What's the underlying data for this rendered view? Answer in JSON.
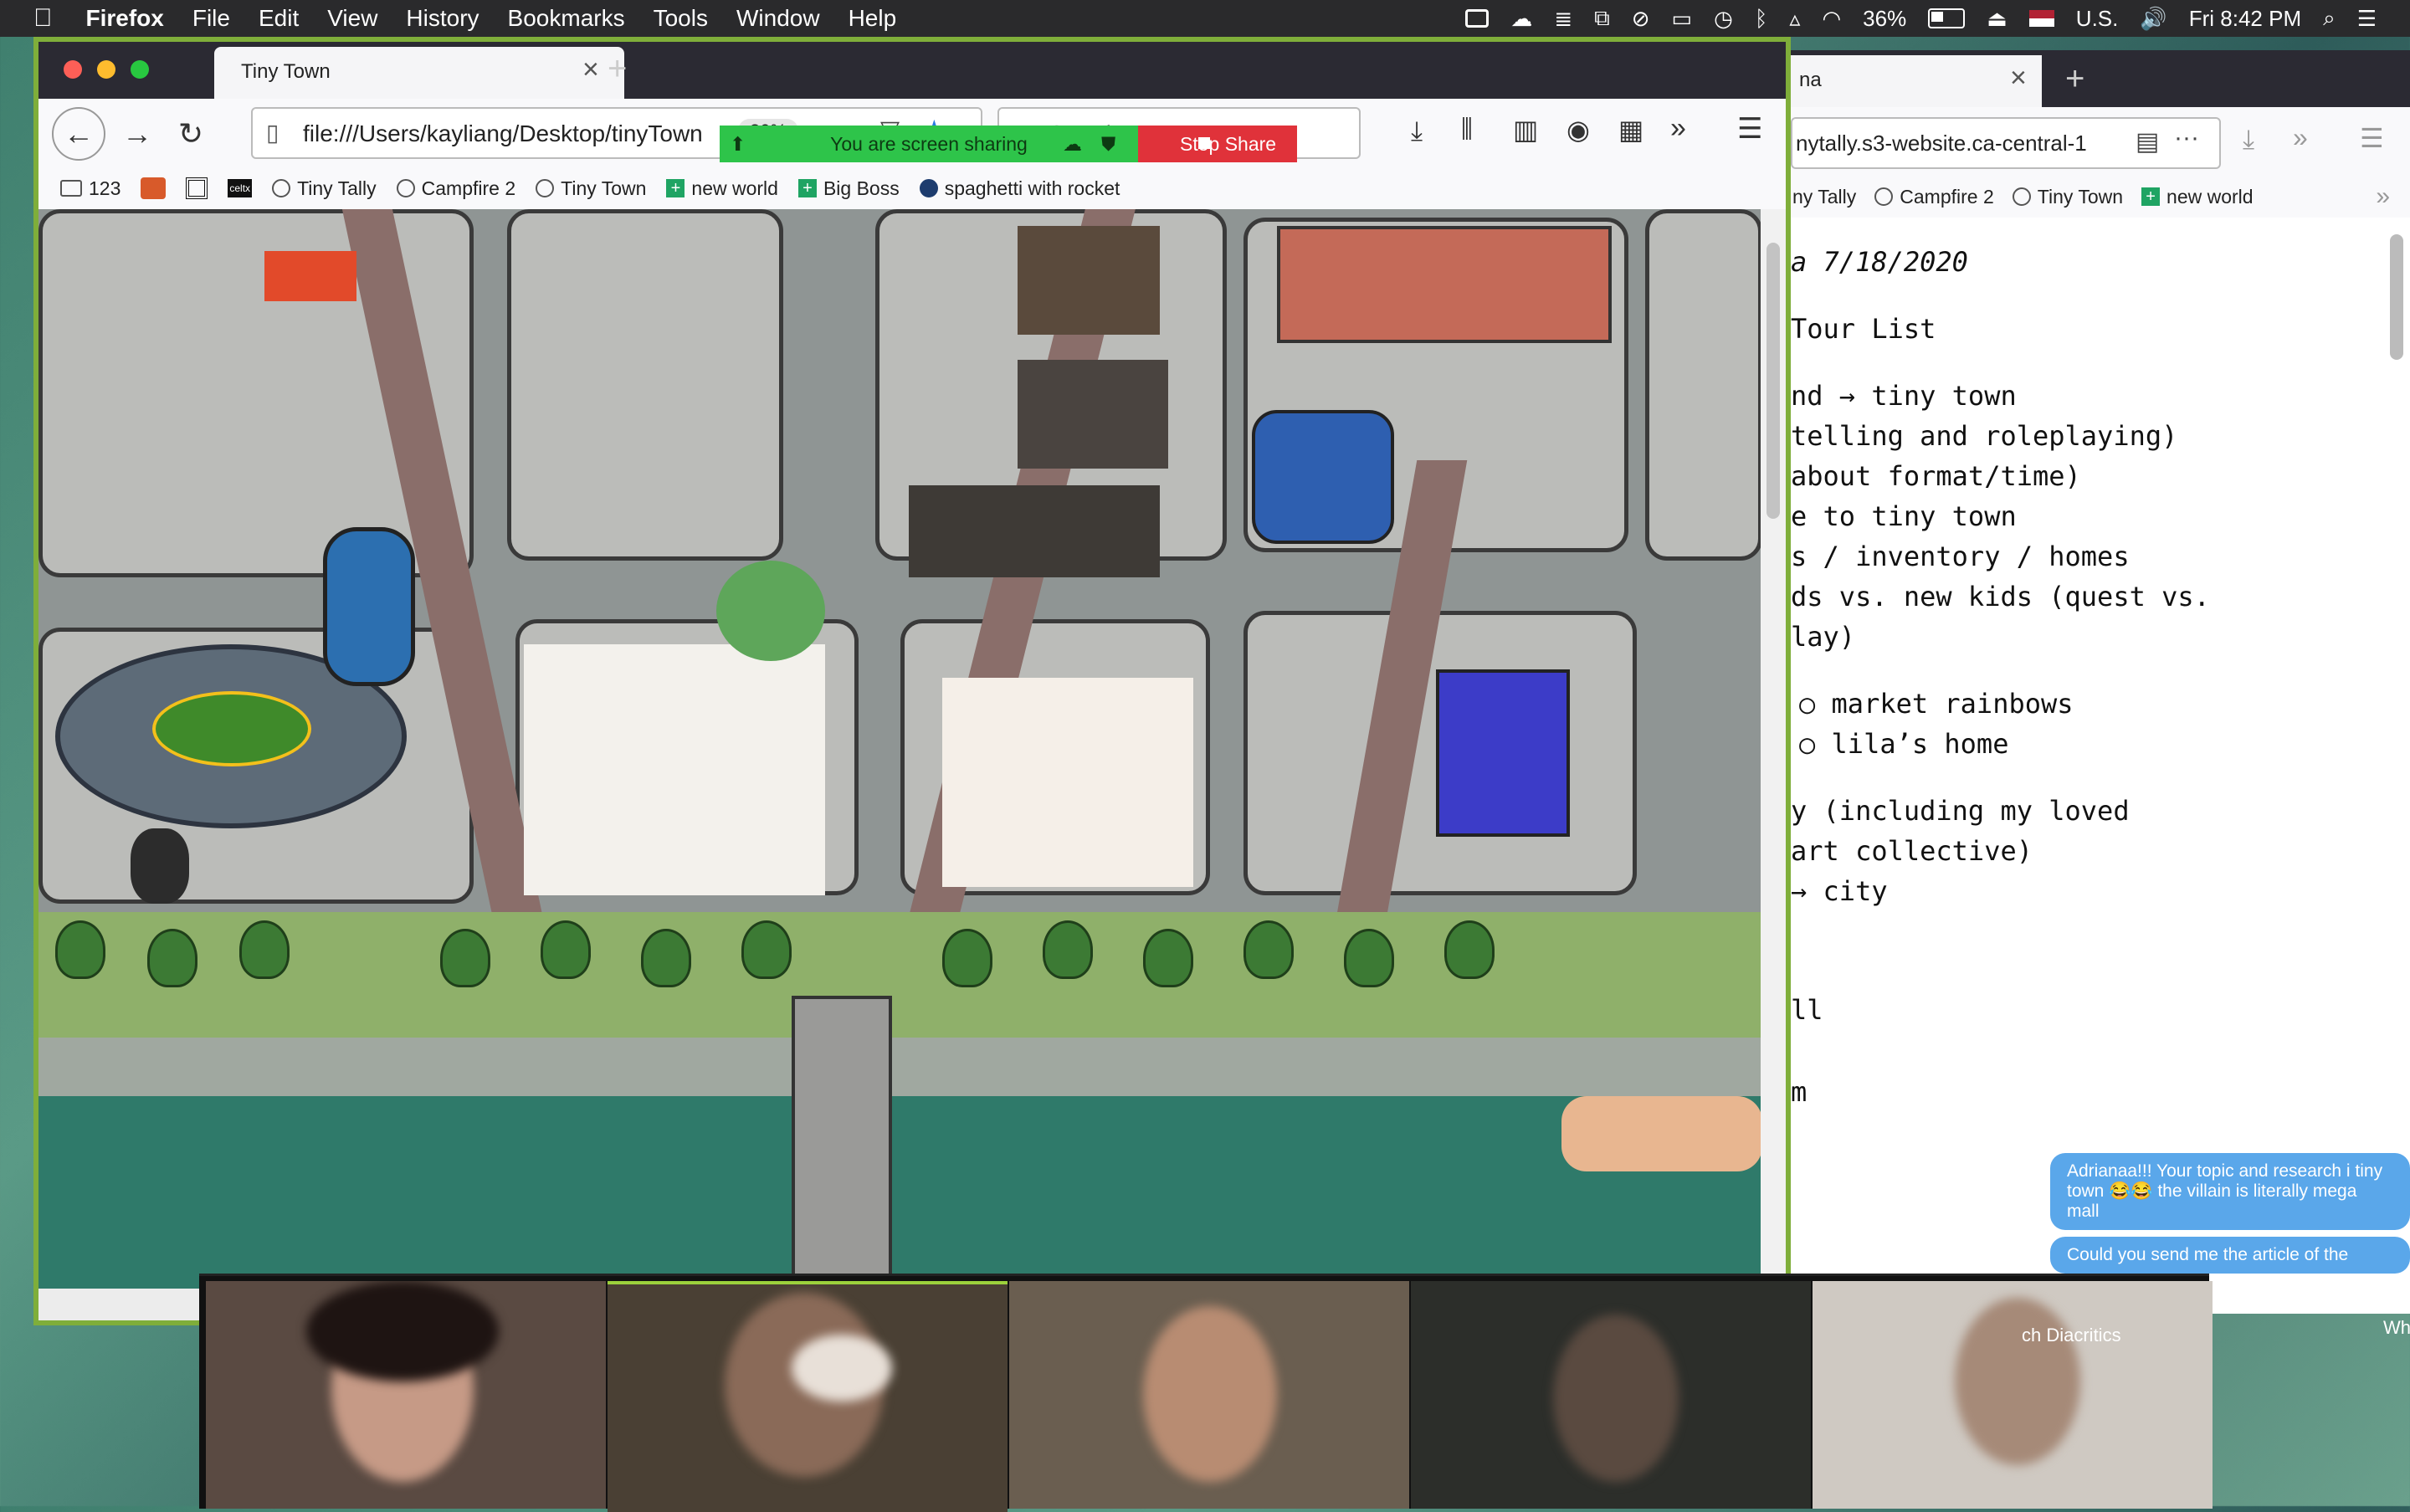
{
  "menubar": {
    "apple": "",
    "app": "Firefox",
    "menus": [
      "File",
      "Edit",
      "View",
      "History",
      "Bookmarks",
      "Tools",
      "Window",
      "Help"
    ],
    "battery": "36%",
    "input_source": "U.S.",
    "clock": "Fri 8:42 PM"
  },
  "browser_left": {
    "tab_title": "Tiny Town",
    "url": "file:///Users/kayliang/Desktop/tinyTown",
    "zoom": "30%",
    "search_placeholder": "Search",
    "bookmarks": [
      "123",
      "Tiny Tally",
      "Campfire 2",
      "Tiny Town",
      "new world",
      "Big Boss",
      "spaghetti with rocket"
    ],
    "bookmark_celtx": "celtx"
  },
  "share_banner": {
    "status": "You are screen sharing",
    "stop_label": "Stop Share"
  },
  "browser_right": {
    "tab_title": "na",
    "url": "nytally.s3-website.ca-central-1",
    "bookmarks": [
      "ny Tally",
      "Campfire 2",
      "Tiny Town",
      "new world"
    ],
    "doc_lines": [
      "a    7/18/2020",
      "Tour List",
      "nd → tiny town",
      "telling and roleplaying)",
      "about format/time)",
      "e to tiny town",
      "s / inventory / homes",
      "ds vs. new kids (quest vs.",
      "lay)",
      "○ market rainbows",
      "○ lila’s home",
      "y (including my loved",
      "art collective)",
      " → city",
      "ll",
      "m"
    ],
    "chat": [
      "Adrianaa!!! Your topic and research i tiny town 😂😂 the villain is literally mega mall",
      "Could you send me the article of the"
    ]
  },
  "video_strip": {
    "label_1": "ch Diacritics",
    "label_2": "Wh"
  },
  "colors": {
    "accent_green": "#2ec44a",
    "stop_red": "#e0323a",
    "window_border": "#7fae3a",
    "chat_blue": "#5aa7ea"
  }
}
